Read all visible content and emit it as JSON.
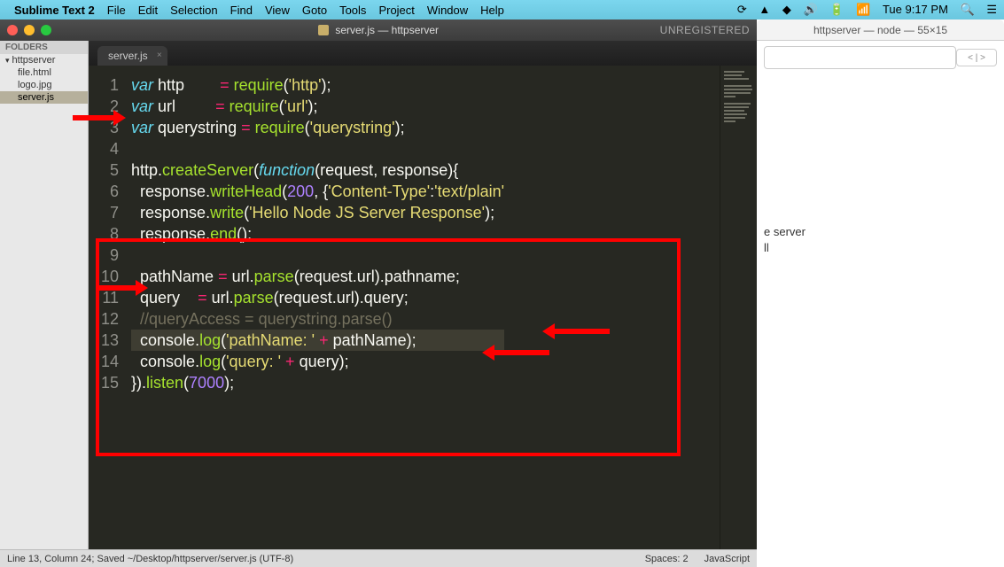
{
  "menubar": {
    "app_name": "Sublime Text 2",
    "menus": [
      "File",
      "Edit",
      "Selection",
      "Find",
      "View",
      "Goto",
      "Tools",
      "Project",
      "Window",
      "Help"
    ],
    "clock": "Tue 9:17 PM"
  },
  "terminal": {
    "title": "httpserver — node — 55×15",
    "nav_chips": "< | >",
    "lines": [
      "e server",
      "",
      "ll"
    ]
  },
  "sublime": {
    "title_file": "server.js",
    "title_project": "httpserver",
    "unregistered": "UNREGISTERED",
    "tab": {
      "label": "server.js"
    },
    "sidebar": {
      "header": "FOLDERS",
      "folder": "httpserver",
      "files": [
        "file.html",
        "logo.jpg",
        "server.js"
      ],
      "selected_index": 2
    },
    "code": {
      "lines": [
        {
          "n": 1,
          "tokens": [
            [
              "kw",
              "var"
            ],
            [
              "p",
              " "
            ],
            [
              "id",
              "http"
            ],
            [
              "p",
              "        "
            ],
            [
              "op",
              "="
            ],
            [
              "p",
              " "
            ],
            [
              "fn",
              "require"
            ],
            [
              "p",
              "("
            ],
            [
              "s",
              "'http'"
            ],
            [
              "p",
              ");"
            ]
          ]
        },
        {
          "n": 2,
          "tokens": [
            [
              "kw",
              "var"
            ],
            [
              "p",
              " "
            ],
            [
              "id",
              "url"
            ],
            [
              "p",
              "         "
            ],
            [
              "op",
              "="
            ],
            [
              "p",
              " "
            ],
            [
              "fn",
              "require"
            ],
            [
              "p",
              "("
            ],
            [
              "s",
              "'url'"
            ],
            [
              "p",
              ");"
            ]
          ]
        },
        {
          "n": 3,
          "tokens": [
            [
              "kw",
              "var"
            ],
            [
              "p",
              " "
            ],
            [
              "id",
              "querystring"
            ],
            [
              "p",
              " "
            ],
            [
              "op",
              "="
            ],
            [
              "p",
              " "
            ],
            [
              "fn",
              "require"
            ],
            [
              "p",
              "("
            ],
            [
              "s",
              "'querystring'"
            ],
            [
              "p",
              ");"
            ]
          ]
        },
        {
          "n": 4,
          "tokens": []
        },
        {
          "n": 5,
          "tokens": [
            [
              "id",
              "http"
            ],
            [
              "p",
              "."
            ],
            [
              "fn",
              "createServer"
            ],
            [
              "p",
              "("
            ],
            [
              "storage",
              "function"
            ],
            [
              "p",
              "("
            ],
            [
              "id",
              "request"
            ],
            [
              "p",
              ", "
            ],
            [
              "id",
              "response"
            ],
            [
              "p",
              "){"
            ]
          ]
        },
        {
          "n": 6,
          "tokens": [
            [
              "p",
              "  "
            ],
            [
              "id",
              "response"
            ],
            [
              "p",
              "."
            ],
            [
              "fn",
              "writeHead"
            ],
            [
              "p",
              "("
            ],
            [
              "num",
              "200"
            ],
            [
              "p",
              ", {"
            ],
            [
              "s",
              "'Content-Type'"
            ],
            [
              "p",
              ":"
            ],
            [
              "s",
              "'text/plain'"
            ]
          ]
        },
        {
          "n": 7,
          "tokens": [
            [
              "p",
              "  "
            ],
            [
              "id",
              "response"
            ],
            [
              "p",
              "."
            ],
            [
              "fn",
              "write"
            ],
            [
              "p",
              "("
            ],
            [
              "s",
              "'Hello Node JS Server Response'"
            ],
            [
              "p",
              ");"
            ]
          ]
        },
        {
          "n": 8,
          "tokens": [
            [
              "p",
              "  "
            ],
            [
              "id",
              "response"
            ],
            [
              "p",
              "."
            ],
            [
              "fn",
              "end"
            ],
            [
              "p",
              "();"
            ]
          ]
        },
        {
          "n": 9,
          "tokens": []
        },
        {
          "n": 10,
          "tokens": [
            [
              "p",
              "  "
            ],
            [
              "id",
              "pathName"
            ],
            [
              "p",
              " "
            ],
            [
              "op",
              "="
            ],
            [
              "p",
              " "
            ],
            [
              "id",
              "url"
            ],
            [
              "p",
              "."
            ],
            [
              "fn",
              "parse"
            ],
            [
              "p",
              "("
            ],
            [
              "id",
              "request"
            ],
            [
              "p",
              "."
            ],
            [
              "id",
              "url"
            ],
            [
              "p",
              ")."
            ],
            [
              "id",
              "pathname"
            ],
            [
              "p",
              ";"
            ]
          ]
        },
        {
          "n": 11,
          "tokens": [
            [
              "p",
              "  "
            ],
            [
              "id",
              "query"
            ],
            [
              "p",
              "    "
            ],
            [
              "op",
              "="
            ],
            [
              "p",
              " "
            ],
            [
              "id",
              "url"
            ],
            [
              "p",
              "."
            ],
            [
              "fn",
              "parse"
            ],
            [
              "p",
              "("
            ],
            [
              "id",
              "request"
            ],
            [
              "p",
              "."
            ],
            [
              "id",
              "url"
            ],
            [
              "p",
              ")."
            ],
            [
              "id",
              "query"
            ],
            [
              "p",
              ";"
            ]
          ]
        },
        {
          "n": 12,
          "tokens": [
            [
              "p",
              "  "
            ],
            [
              "cm",
              "//queryAccess = querystring.parse()"
            ]
          ]
        },
        {
          "n": 13,
          "hl": true,
          "tokens": [
            [
              "p",
              "  "
            ],
            [
              "id",
              "console"
            ],
            [
              "p",
              "."
            ],
            [
              "fn",
              "log"
            ],
            [
              "p",
              "("
            ],
            [
              "s",
              "'pathName: '"
            ],
            [
              "p",
              " "
            ],
            [
              "op",
              "+"
            ],
            [
              "p",
              " "
            ],
            [
              "id",
              "pathName"
            ],
            [
              "p",
              ");"
            ]
          ]
        },
        {
          "n": 14,
          "tokens": [
            [
              "p",
              "  "
            ],
            [
              "id",
              "console"
            ],
            [
              "p",
              "."
            ],
            [
              "fn",
              "log"
            ],
            [
              "p",
              "("
            ],
            [
              "s",
              "'query: '"
            ],
            [
              "p",
              " "
            ],
            [
              "op",
              "+"
            ],
            [
              "p",
              " "
            ],
            [
              "id",
              "query"
            ],
            [
              "p",
              ");"
            ]
          ]
        },
        {
          "n": 15,
          "tokens": [
            [
              "p",
              "})."
            ],
            [
              "fn",
              "listen"
            ],
            [
              "p",
              "("
            ],
            [
              "num",
              "7000"
            ],
            [
              "p",
              ");"
            ]
          ]
        }
      ]
    },
    "statusbar": {
      "left": "Line 13, Column 24; Saved ~/Desktop/httpserver/server.js (UTF-8)",
      "spaces": "Spaces: 2",
      "syntax": "JavaScript"
    }
  }
}
